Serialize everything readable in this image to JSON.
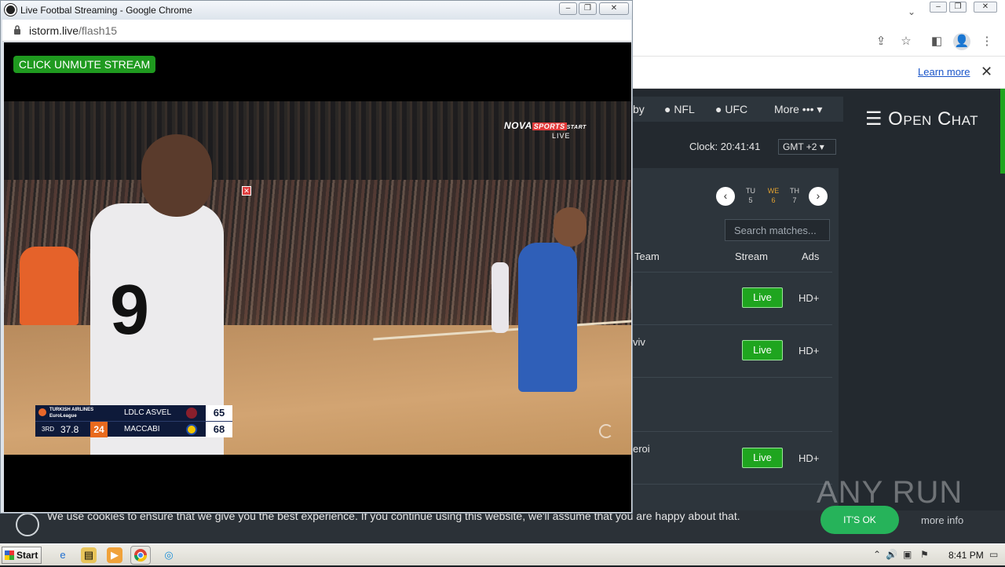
{
  "popup": {
    "title": "Live Footbal Streaming - Google Chrome",
    "url_host": "istorm.live",
    "url_path": "/flash15",
    "unmute_label": "CLICK UNMUTE STREAM",
    "broadcaster": {
      "name_a": "NOVA",
      "name_b": "SPORTS",
      "name_c": "START",
      "live": "LIVE"
    },
    "scorebug": {
      "league_line1": "TURKISH AIRLINES",
      "league_line2": "EuroLeague",
      "team1": "LDLC ASVEL",
      "score1": "65",
      "team2": "MACCABI",
      "score2": "68",
      "period": "3RD",
      "clock": "37.8",
      "shot_clock": "24"
    }
  },
  "background_site": {
    "learn_more": "Learn more",
    "nav": [
      "by",
      "NFL",
      "UFC",
      "More •••"
    ],
    "open_chat": "☰ Open Chat",
    "clock_label": "Clock: 20:41:41",
    "timezone": "GMT +2",
    "days": [
      {
        "dow": "TU",
        "num": "5"
      },
      {
        "dow": "WE",
        "num": "6"
      },
      {
        "dow": "TH",
        "num": "7"
      }
    ],
    "search_placeholder": "Search matches...",
    "columns": {
      "team": "Team",
      "stream": "Stream",
      "ads": "Ads"
    },
    "rows": [
      {
        "team": "",
        "stream": "Live",
        "ads": "HD+"
      },
      {
        "team": "viv",
        "stream": "Live",
        "ads": "HD+"
      },
      {
        "team": "",
        "stream": "",
        "ads": ""
      },
      {
        "team": "eroi",
        "stream": "Live",
        "ads": "HD+"
      }
    ]
  },
  "cookie_bar": {
    "text": "We use cookies to ensure that we give you the best experience. If you continue using this website, we'll assume that you are happy about that.",
    "ok": "IT'S OK",
    "more_info": "more info"
  },
  "watermark": "ANY RUN",
  "taskbar": {
    "start": "Start",
    "time": "8:41 PM"
  }
}
